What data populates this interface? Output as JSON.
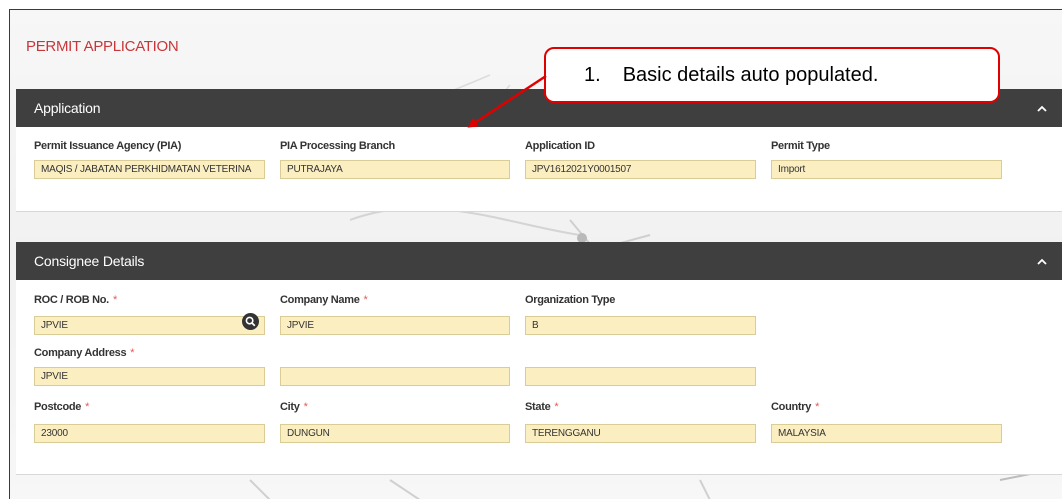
{
  "page": {
    "title": "PERMIT APPLICATION"
  },
  "callout": {
    "number": "1.",
    "text": "Basic details auto populated."
  },
  "application": {
    "header": "Application",
    "fields": {
      "pia": {
        "label": "Permit Issuance Agency (PIA)",
        "value": "MAQIS / JABATAN PERKHIDMATAN VETERINA"
      },
      "branch": {
        "label": "PIA Processing Branch",
        "value": "PUTRAJAYA"
      },
      "app_id": {
        "label": "Application ID",
        "value": "JPV1612021Y0001507"
      },
      "permit_type": {
        "label": "Permit Type",
        "value": "Import"
      }
    }
  },
  "consignee": {
    "header": "Consignee Details",
    "required_marker": "*",
    "fields": {
      "roc": {
        "label": "ROC / ROB No.",
        "value": "JPVIE"
      },
      "company_name": {
        "label": "Company Name",
        "value": "JPVIE"
      },
      "org_type": {
        "label": "Organization Type",
        "value": "B"
      },
      "address": {
        "label": "Company Address",
        "line1": "JPVIE",
        "line2": "",
        "line3": ""
      },
      "postcode": {
        "label": "Postcode",
        "value": "23000"
      },
      "city": {
        "label": "City",
        "value": "DUNGUN"
      },
      "state": {
        "label": "State",
        "value": "TERENGGANU"
      },
      "country": {
        "label": "Country",
        "value": "MALAYSIA"
      }
    }
  },
  "icons": {
    "collapse": "chevron-up-icon",
    "search": "search-icon"
  },
  "colors": {
    "title": "#c8363a",
    "header_bg": "#3f3f3f",
    "field_bg": "#fbefc2",
    "callout_border": "#e00000",
    "required": "#e05a5a"
  }
}
